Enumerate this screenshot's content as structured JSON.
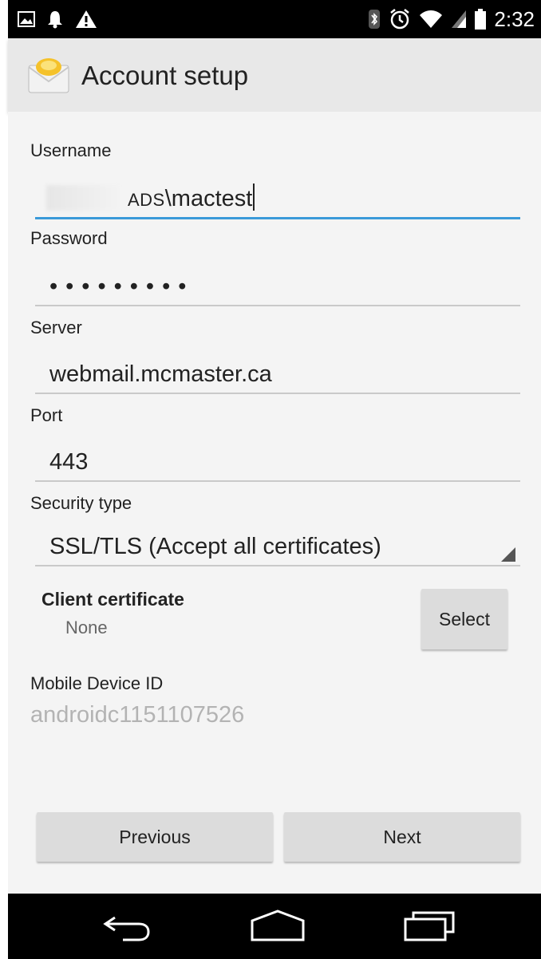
{
  "status_bar": {
    "time": "2:32",
    "left_icons": [
      "image-icon",
      "notification-bell-icon",
      "warning-icon"
    ],
    "right_icons": [
      "bluetooth-icon",
      "alarm-icon",
      "wifi-icon",
      "signal-icon",
      "battery-icon"
    ]
  },
  "action_bar": {
    "title": "Account setup",
    "app_icon": "email-app-icon"
  },
  "form": {
    "username": {
      "label": "Username",
      "prefix": "ADS",
      "value": "\\mactest"
    },
    "password": {
      "label": "Password",
      "value": "•••••••••"
    },
    "server": {
      "label": "Server",
      "value": "webmail.mcmaster.ca"
    },
    "port": {
      "label": "Port",
      "value": "443"
    },
    "security": {
      "label": "Security type",
      "value": "SSL/TLS (Accept all certificates)"
    },
    "client_certificate": {
      "label": "Client certificate",
      "value": "None",
      "button": "Select"
    },
    "mobile_device_id": {
      "label": "Mobile Device ID",
      "value": "androidc1151107526"
    }
  },
  "buttons": {
    "previous": "Previous",
    "next": "Next"
  },
  "navigation": {
    "icons": [
      "back-icon",
      "home-icon",
      "recent-apps-icon"
    ]
  },
  "colors": {
    "focus_underline": "#3a9ad9",
    "action_bar_bg": "#e8e8e8",
    "content_bg": "#f4f4f4",
    "button_bg": "#dcdcdc"
  }
}
